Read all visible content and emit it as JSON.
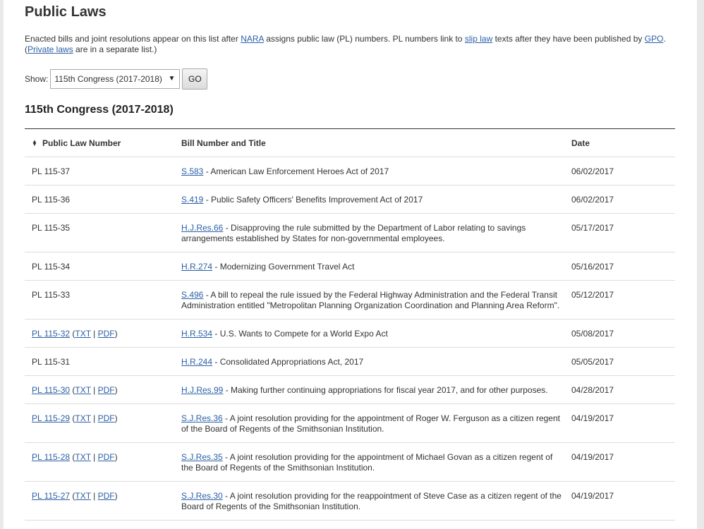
{
  "page_title": "Public Laws",
  "intro": {
    "t1": "Enacted bills and joint resolutions appear on this list after ",
    "nara": "NARA",
    "t2": " assigns public law (PL) numbers. PL numbers link to ",
    "slip_law": "slip law",
    "t3": " texts after they have been published by ",
    "gpo": "GPO",
    "t4": ". (",
    "private_laws": "Private laws",
    "t5": " are in a separate list.)"
  },
  "filter": {
    "show_label": "Show:",
    "selected": "115th Congress (2017-2018)",
    "go_label": "GO"
  },
  "section_title": "115th Congress (2017-2018)",
  "table": {
    "headers": {
      "law_number": "Public Law Number",
      "bill": "Bill Number and Title",
      "date": "Date"
    },
    "rows": [
      {
        "law": "PL 115-37",
        "law_link": false,
        "bill": "S.583",
        "title": " - American Law Enforcement Heroes Act of 2017",
        "date": "06/02/2017"
      },
      {
        "law": "PL 115-36",
        "law_link": false,
        "bill": "S.419",
        "title": " - Public Safety Officers' Benefits Improvement Act of 2017",
        "date": "06/02/2017"
      },
      {
        "law": "PL 115-35",
        "law_link": false,
        "bill": "H.J.Res.66",
        "title": " - Disapproving the rule submitted by the Department of Labor relating to savings arrangements established by States for non-governmental employees.",
        "date": "05/17/2017"
      },
      {
        "law": "PL 115-34",
        "law_link": false,
        "bill": "H.R.274",
        "title": " - Modernizing Government Travel Act",
        "date": "05/16/2017"
      },
      {
        "law": "PL 115-33",
        "law_link": false,
        "bill": "S.496",
        "title": " - A bill to repeal the rule issued by the Federal Highway Administration and the Federal Transit Administration entitled \"Metropolitan Planning Organization Coordination and Planning Area Reform\".",
        "date": "05/12/2017"
      },
      {
        "law": "PL 115-32",
        "law_link": true,
        "txt": "TXT",
        "pdf": "PDF",
        "bill": "H.R.534",
        "title": " - U.S. Wants to Compete for a World Expo Act",
        "date": "05/08/2017"
      },
      {
        "law": "PL 115-31",
        "law_link": false,
        "bill": "H.R.244",
        "title": " - Consolidated Appropriations Act, 2017",
        "date": "05/05/2017"
      },
      {
        "law": "PL 115-30",
        "law_link": true,
        "txt": "TXT",
        "pdf": "PDF",
        "bill": "H.J.Res.99",
        "title": " - Making further continuing appropriations for fiscal year 2017, and for other purposes.",
        "date": "04/28/2017"
      },
      {
        "law": "PL 115-29",
        "law_link": true,
        "txt": "TXT",
        "pdf": "PDF",
        "bill": "S.J.Res.36",
        "title": " - A joint resolution providing for the appointment of Roger W. Ferguson as a citizen regent of the Board of Regents of the Smithsonian Institution.",
        "date": "04/19/2017"
      },
      {
        "law": "PL 115-28",
        "law_link": true,
        "txt": "TXT",
        "pdf": "PDF",
        "bill": "S.J.Res.35",
        "title": " - A joint resolution providing for the appointment of Michael Govan as a citizen regent of the Board of Regents of the Smithsonian Institution.",
        "date": "04/19/2017"
      },
      {
        "law": "PL 115-27",
        "law_link": true,
        "txt": "TXT",
        "pdf": "PDF",
        "bill": "S.J.Res.30",
        "title": " - A joint resolution providing for the reappointment of Steve Case as a citizen regent of the Board of Regents of the Smithsonian Institution.",
        "date": "04/19/2017"
      }
    ]
  }
}
